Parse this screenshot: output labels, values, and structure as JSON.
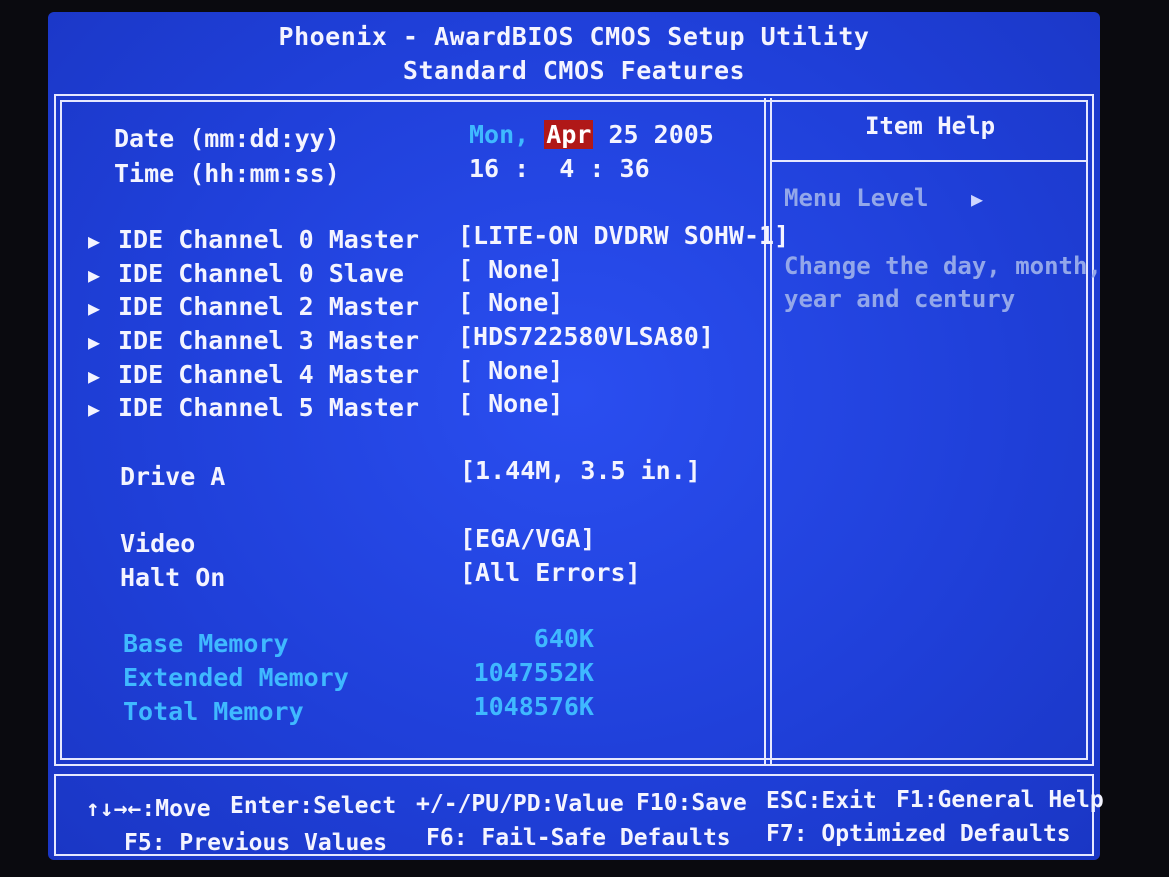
{
  "header": {
    "title": "Phoenix - AwardBIOS CMOS Setup Utility",
    "subtitle": "Standard CMOS Features"
  },
  "date": {
    "label": "Date (mm:dd:yy)",
    "day_name": "Mon,",
    "month": "Apr",
    "day_year": "25 2005"
  },
  "time": {
    "label": "Time (hh:mm:ss)",
    "value": "16 :  4 : 36"
  },
  "ide_channels": [
    {
      "label": "IDE Channel 0 Master",
      "value": "[LITE-ON DVDRW SOHW-1]"
    },
    {
      "label": "IDE Channel 0 Slave",
      "value": "[ None]"
    },
    {
      "label": "IDE Channel 2 Master",
      "value": "[ None]"
    },
    {
      "label": "IDE Channel 3 Master",
      "value": "[HDS722580VLSA80]"
    },
    {
      "label": "IDE Channel 4 Master",
      "value": "[ None]"
    },
    {
      "label": "IDE Channel 5 Master",
      "value": "[ None]"
    }
  ],
  "drive_a": {
    "label": "Drive A",
    "value": "[1.44M, 3.5 in.]"
  },
  "video": {
    "label": "Video",
    "value": "[EGA/VGA]"
  },
  "halt_on": {
    "label": "Halt On",
    "value": "[All Errors]"
  },
  "memory": [
    {
      "label": "Base Memory",
      "value": "640K"
    },
    {
      "label": "Extended Memory",
      "value": "1047552K"
    },
    {
      "label": "Total Memory",
      "value": "1048576K"
    }
  ],
  "help": {
    "title": "Item Help",
    "menu_level": "Menu Level",
    "line1": "Change the day, month,",
    "line2": "year and century"
  },
  "footer": {
    "move": "↑↓→←:Move",
    "enter": "Enter:Select",
    "value": "+/-/PU/PD:Value",
    "save": "F10:Save",
    "exit": "ESC:Exit",
    "help": "F1:General Help",
    "prev": "F5: Previous Values",
    "failsafe": "F6: Fail-Safe Defaults",
    "optimized": "F7: Optimized Defaults"
  },
  "colors": {
    "background": "#1f3fd8",
    "text": "#f4f4ff",
    "dim_text": "#3fb9ff",
    "highlight": "#b01818"
  }
}
